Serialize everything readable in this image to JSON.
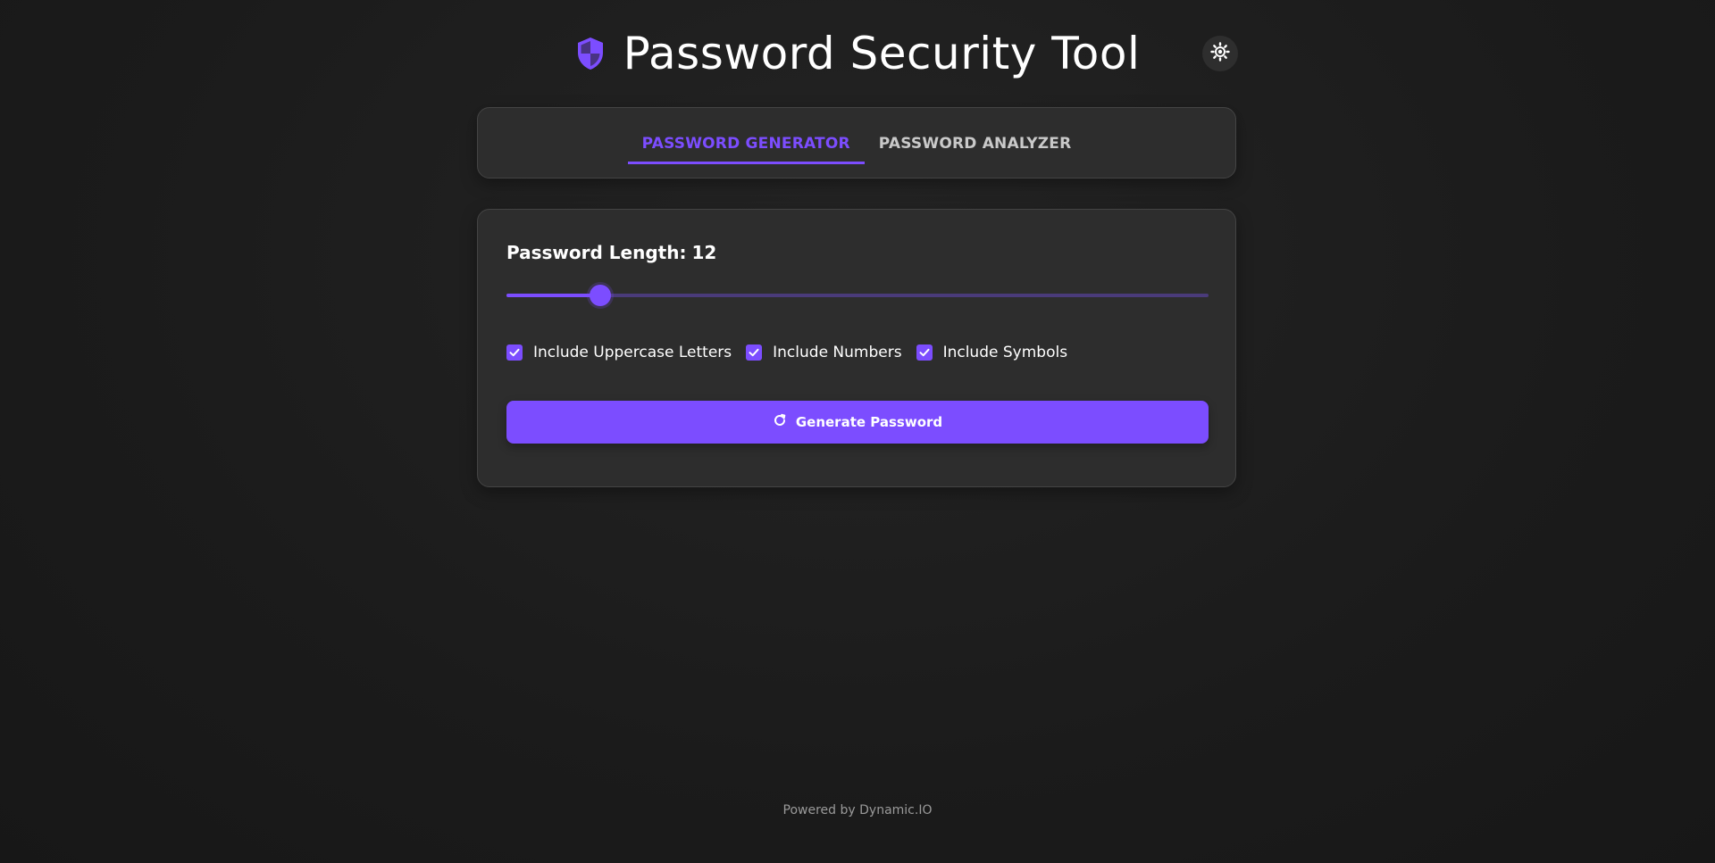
{
  "header": {
    "title": "Password Security Tool",
    "logo_icon": "shield-icon",
    "theme_toggle_icon": "sun-icon"
  },
  "tabs": [
    {
      "label": "PASSWORD GENERATOR",
      "active": true
    },
    {
      "label": "PASSWORD ANALYZER",
      "active": false
    }
  ],
  "generator": {
    "length_label": "Password Length:",
    "length_value": "12",
    "slider": {
      "min": 4,
      "max": 64,
      "value": 12
    },
    "options": [
      {
        "label": "Include Uppercase Letters",
        "checked": true
      },
      {
        "label": "Include Numbers",
        "checked": true
      },
      {
        "label": "Include Symbols",
        "checked": true
      }
    ],
    "generate_button": {
      "label": "Generate Password",
      "icon": "refresh-icon"
    }
  },
  "footer": {
    "text": "Powered by Dynamic.IO"
  },
  "colors": {
    "accent": "#7c4dff",
    "background": "#1c1c1c",
    "card": "#2d2d2d"
  }
}
